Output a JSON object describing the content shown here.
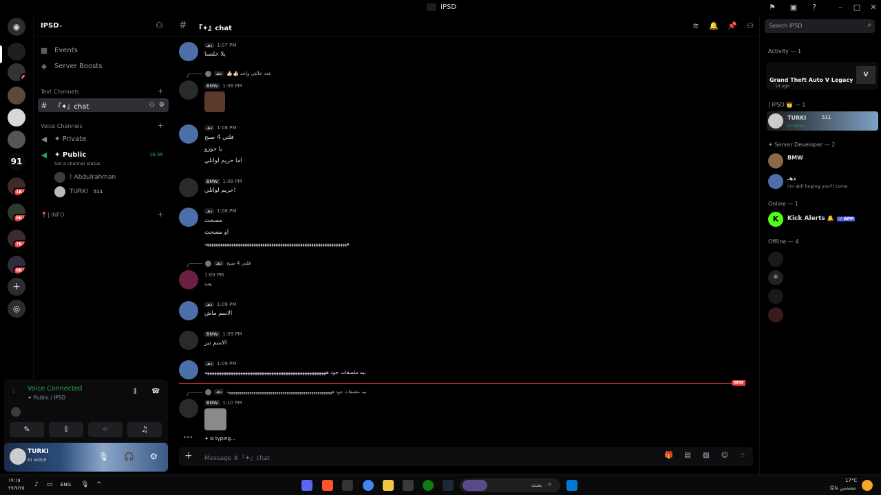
{
  "window": {
    "title": "IPSD"
  },
  "server": {
    "name": "IPSD",
    "badges": [
      "1",
      "1K+",
      "9K+",
      "7K+",
      "8K+"
    ],
    "rail_number": "91"
  },
  "sidebar": {
    "events": "Events",
    "boosts": "Server Boosts",
    "text_channels": "Text Channels",
    "chat_channel": "『✦』chat",
    "voice_channels": "Voice Channels",
    "private_channel": "✦ Private",
    "public_channel": "✦ Public",
    "public_timer": "16:46",
    "channel_status": "Set a channel status",
    "voice_users": [
      "! Abdulrahman",
      "TURKI"
    ],
    "voice_user_tag": "511",
    "info_category": "📍| INFO"
  },
  "voice_panel": {
    "status": "Voice Connected",
    "location": "✦ Public / IPSD"
  },
  "user_panel": {
    "name": "TURKI",
    "status": "In voice"
  },
  "chat": {
    "hash": "#",
    "channel_name": "『✦』chat",
    "messages": [
      {
        "tag": "ذهـ",
        "time": "1:07 PM",
        "lines": [
          "يلا خلصنا"
        ]
      },
      {
        "reply_tag": "ذهـ",
        "reply_text": "👍🏻👍🏻 عدد خالتي واحد",
        "tag": "BMW",
        "time": "1:08 PM",
        "lines": []
      },
      {
        "tag": "ذهـ",
        "time": "1:08 PM",
        "lines": [
          "فلتي 4 صبح",
          "يا جورو",
          "اما حريم لواتلي"
        ]
      },
      {
        "tag": "BMW",
        "time": "1:08 PM",
        "lines": [
          "حريم لواتلي!"
        ]
      },
      {
        "tag": "ذهـ",
        "time": "1:08 PM",
        "lines": [
          "مسحت",
          "او مسحت",
          "ههههههههههههههههههههههههههههههههههههههههههههههههههههههههههههههههه"
        ]
      },
      {
        "reply_tag": "ذهـ",
        "reply_text": "فلتي 4 صبح",
        "tag": "",
        "time": "1:09 PM",
        "lines": [
          "يب"
        ]
      },
      {
        "tag": "ذهـ",
        "time": "1:09 PM",
        "lines": [
          "الاسم ماش"
        ]
      },
      {
        "tag": "BMW",
        "time": "1:09 PM",
        "lines": [
          "الاسم تبر"
        ]
      },
      {
        "tag": "ذهـ",
        "time": "1:09 PM",
        "lines": [
          "بيه ملصقات جود هههههههههههههههههههههههههههههههههههههههههههههههههههه"
        ]
      },
      {
        "reply_tag": "ذهـ",
        "reply_text": "بيه ملصقات جود هههههههههههههههههههههههههههههههههههههههههههههههههههه",
        "tag": "BMW",
        "time": "1:10 PM",
        "lines": []
      }
    ],
    "new_label": "NEW",
    "typing": "✦ is typing...",
    "composer_placeholder": "Message #『✦』chat"
  },
  "members": {
    "search_placeholder": "Search IPSD",
    "activity_header": "Activity — 1",
    "activity_game": "Grand Theft Auto V Legacy",
    "activity_time": "1d ago",
    "role_ipsd": "| IPSD 👑 — 1",
    "turki_name": "TURKI",
    "turki_tag": "511",
    "turki_status": "In voice",
    "role_dev": "✦ Server Developer — 2",
    "dev1_tag": "BMW",
    "dev2_tag": "ذهـ",
    "dev2_status": "I'm still hoping you'll come",
    "online_header": "Online — 1",
    "kick_name": "Kick Alerts",
    "kick_app": "✓ APP",
    "offline_header": "Offline — 4"
  },
  "taskbar": {
    "time": "١٧:١٥",
    "date": "٢٧/٧/٢٥",
    "lang": "ENG",
    "search": "بحث",
    "weather_temp": "17°C",
    "weather_desc": "مشمس غالبًا"
  },
  "colors": {
    "accent": "#5865f2",
    "online": "#23a55a",
    "danger": "#f23f43"
  }
}
